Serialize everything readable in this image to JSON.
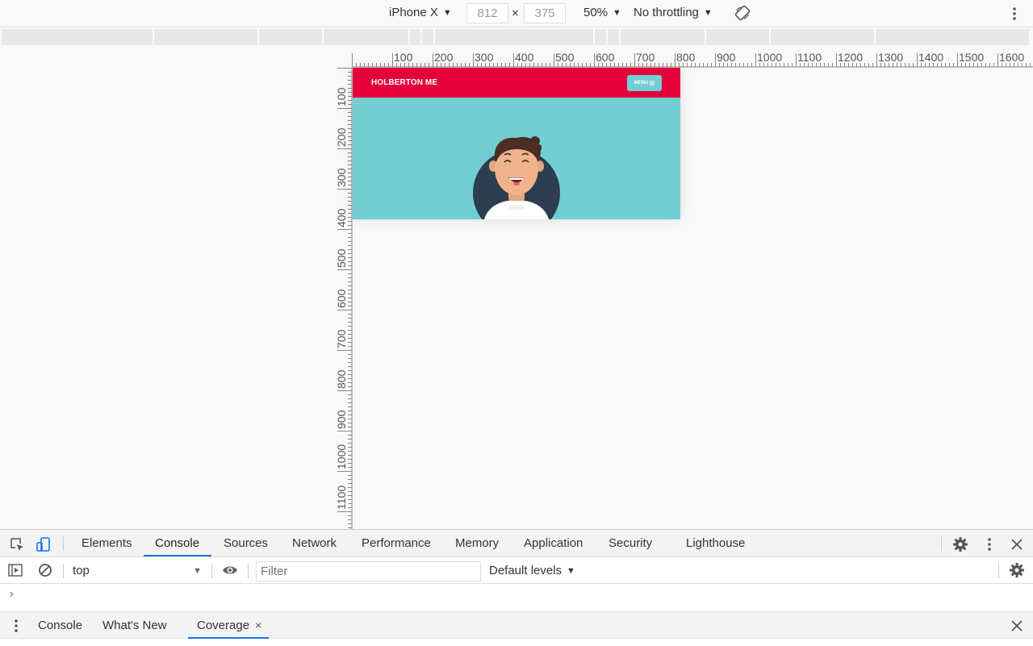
{
  "device_toolbar": {
    "device": "iPhone X",
    "width": "812",
    "height": "375",
    "times": "×",
    "zoom": "50%",
    "throttling": "No throttling"
  },
  "ruler": {
    "h_labels": [
      "100",
      "200",
      "300",
      "400",
      "500",
      "600",
      "700",
      "800",
      "900",
      "1000",
      "1100",
      "1200",
      "1300",
      "1400",
      "1500",
      "1600"
    ],
    "v_labels": [
      "100",
      "200",
      "300",
      "400",
      "500",
      "600",
      "700",
      "800",
      "900",
      "1000",
      "1100"
    ]
  },
  "site": {
    "logo": "HOLBERTON ME",
    "menu_label": "MENU",
    "menu_icon": "hamburger-icon",
    "colors": {
      "header": "#e4003a",
      "hero": "#72ced3",
      "avatar_circle": "#2c3e50"
    }
  },
  "devtools": {
    "tabs": [
      "Elements",
      "Console",
      "Sources",
      "Network",
      "Performance",
      "Memory",
      "Application",
      "Security",
      "Lighthouse"
    ],
    "active_tab": "Console",
    "context": "top",
    "filter_placeholder": "Filter",
    "levels": "Default levels",
    "prompt": "›",
    "drawer_tabs": [
      "Console",
      "What's New",
      "Coverage"
    ],
    "drawer_close": "×",
    "accent": "#1a73e8"
  }
}
